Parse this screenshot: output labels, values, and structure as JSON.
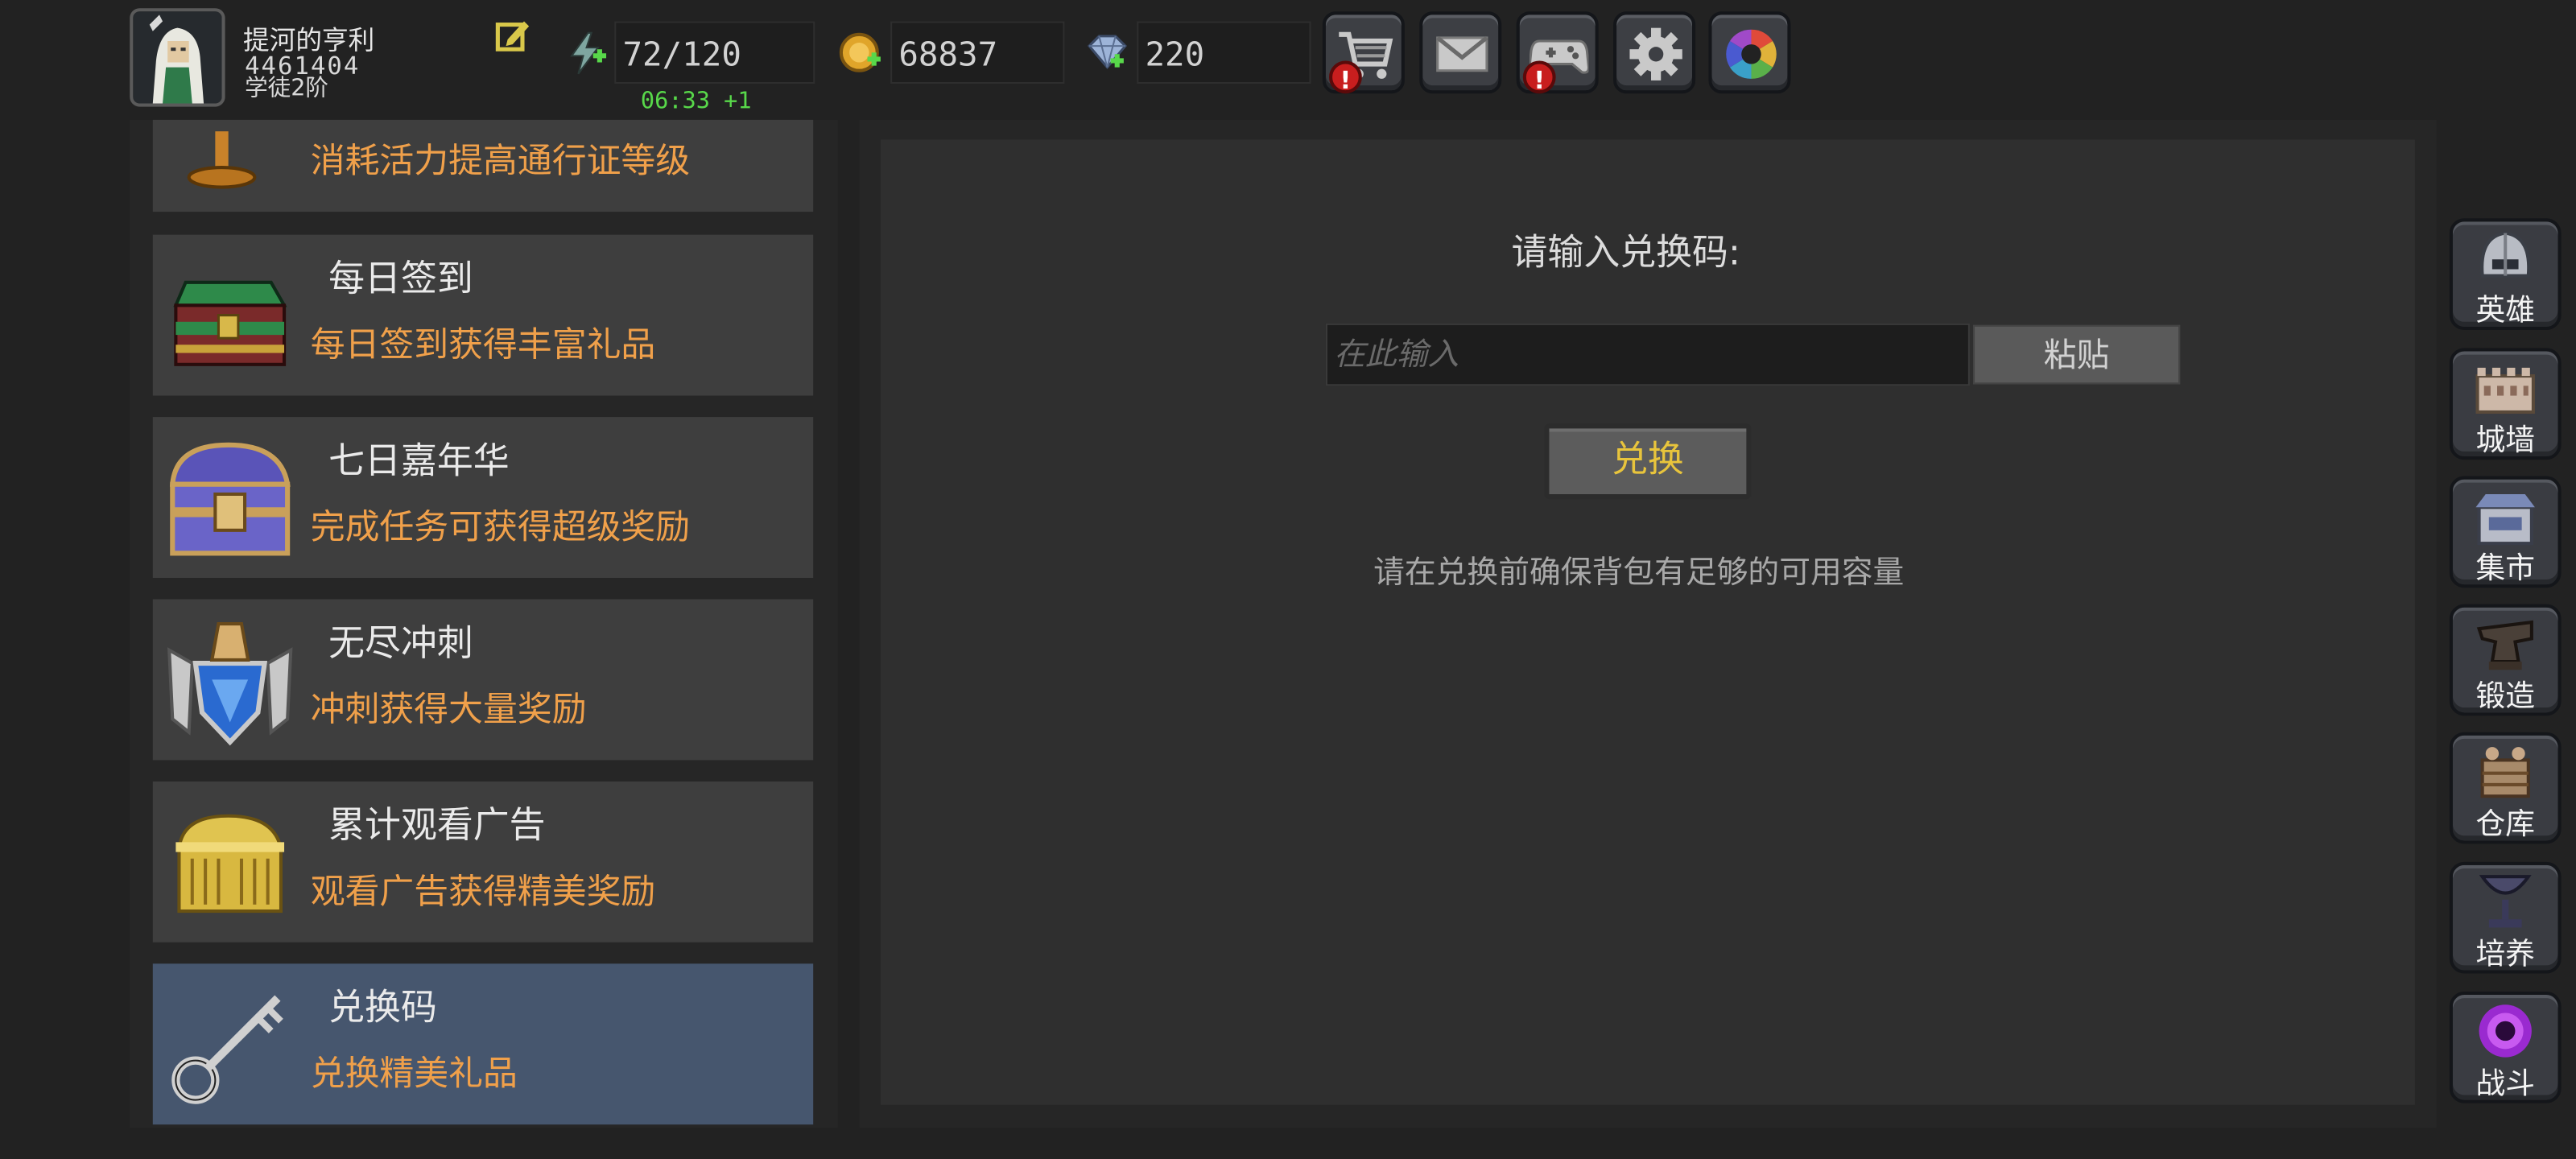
{
  "player": {
    "name": "提河的亨利",
    "id": "4461404",
    "rank": "学徒2阶"
  },
  "resources": {
    "energy": "72/120",
    "energy_timer": "06:33 +1",
    "gold": "68837",
    "gems": "220"
  },
  "top_buttons": [
    {
      "name": "shop",
      "icon": "cart-icon",
      "alert": "!"
    },
    {
      "name": "mail",
      "icon": "envelope-icon"
    },
    {
      "name": "gamepad",
      "icon": "gamepad-icon",
      "alert": "!"
    },
    {
      "name": "settings",
      "icon": "gear-icon"
    },
    {
      "name": "aperture",
      "icon": "aperture-icon"
    }
  ],
  "activities": {
    "partial_desc": "消耗活力提高通行证等级",
    "items": [
      {
        "title": "每日签到",
        "desc": "每日签到获得丰富礼品",
        "icon": "green-chest-icon"
      },
      {
        "title": "七日嘉年华",
        "desc": "完成任务可获得超级奖励",
        "icon": "purple-chest-icon"
      },
      {
        "title": "无尽冲刺",
        "desc": "冲刺获得大量奖励",
        "icon": "crest-icon"
      },
      {
        "title": "累计观看广告",
        "desc": "观看广告获得精美奖励",
        "icon": "gold-chest-icon"
      },
      {
        "title": "兑换码",
        "desc": "兑换精美礼品",
        "icon": "key-icon",
        "active": true
      }
    ]
  },
  "redeem": {
    "prompt": "请输入兑换码:",
    "placeholder": "在此输入",
    "paste": "粘贴",
    "submit": "兑换",
    "notice": "请在兑换前确保背包有足够的可用容量"
  },
  "nav": [
    {
      "label": "英雄",
      "icon": "helmet-icon"
    },
    {
      "label": "城墙",
      "icon": "wall-icon"
    },
    {
      "label": "集市",
      "icon": "market-icon"
    },
    {
      "label": "锻造",
      "icon": "anvil-icon"
    },
    {
      "label": "仓库",
      "icon": "warehouse-icon"
    },
    {
      "label": "培养",
      "icon": "chalice-icon"
    },
    {
      "label": "战斗",
      "icon": "portal-icon"
    }
  ],
  "colors": {
    "background": "#222222",
    "card": "#3e3e3e",
    "card_active": "#46566e",
    "desc_orange": "#f0a04a",
    "timer_green": "#58d84a",
    "redeem_gold": "#e8c43c"
  }
}
